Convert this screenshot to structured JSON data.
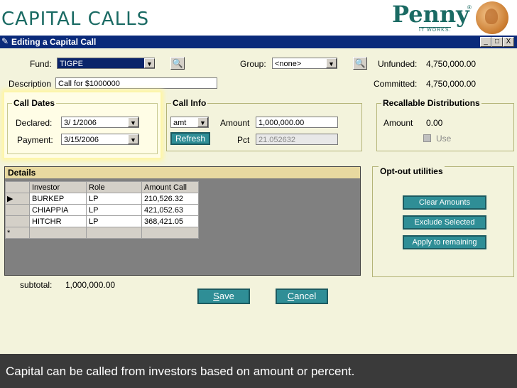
{
  "banner": {
    "title": "CAPITAL CALLS"
  },
  "logo": {
    "word": "Penny",
    "reg": "®",
    "tagline": "IT WORKS."
  },
  "window": {
    "title": "Editing a Capital Call",
    "controls": {
      "min": "_",
      "max": "□",
      "close": "X"
    }
  },
  "form": {
    "fund_label": "Fund:",
    "fund_value": "TIGPE",
    "group_label": "Group:",
    "group_value": "<none>",
    "unfunded_label": "Unfunded:",
    "unfunded_value": "4,750,000.00",
    "committed_label": "Committed:",
    "committed_value": "4,750,000.00",
    "description_label": "Description",
    "description_value": "Call for $1000000"
  },
  "call_dates": {
    "title": "Call Dates",
    "declared_label": "Declared:",
    "declared_value": "3/ 1/2006",
    "payment_label": "Payment:",
    "payment_value": "3/15/2006"
  },
  "call_info": {
    "title": "Call Info",
    "mode_value": "amt",
    "refresh_label": "Refresh",
    "amount_label": "Amount",
    "amount_value": "1,000,000.00",
    "pct_label": "Pct",
    "pct_value": "21.052632"
  },
  "recallable": {
    "title": "Recallable Distributions",
    "amount_label": "Amount",
    "amount_value": "0.00",
    "use_label": "Use"
  },
  "details": {
    "title": "Details",
    "columns": [
      "Investor",
      "Role",
      "Amount Call"
    ],
    "rows": [
      {
        "marker": "▶",
        "investor": "BURKEP",
        "role": "LP",
        "amount": "210,526.32"
      },
      {
        "marker": "",
        "investor": "CHIAPPIA",
        "role": "LP",
        "amount": "421,052.63"
      },
      {
        "marker": "",
        "investor": "HITCHR",
        "role": "LP",
        "amount": "368,421.05"
      },
      {
        "marker": "*",
        "investor": "",
        "role": "",
        "amount": ""
      }
    ],
    "subtotal_label": "subtotal:",
    "subtotal_value": "1,000,000.00"
  },
  "optout": {
    "title": "Opt-out utilities",
    "clear_label": "Clear Amounts",
    "exclude_label": "Exclude Selected",
    "apply_label": "Apply to remaining"
  },
  "actions": {
    "save_rest": "ave",
    "save_key": "S",
    "cancel_rest": "ancel",
    "cancel_key": "C"
  },
  "footer": {
    "caption": "Capital can be called from investors based on amount or percent."
  },
  "colors": {
    "accent": "#1a6a63",
    "titlebar": "#0a2a7a",
    "button": "#2f8e96"
  }
}
